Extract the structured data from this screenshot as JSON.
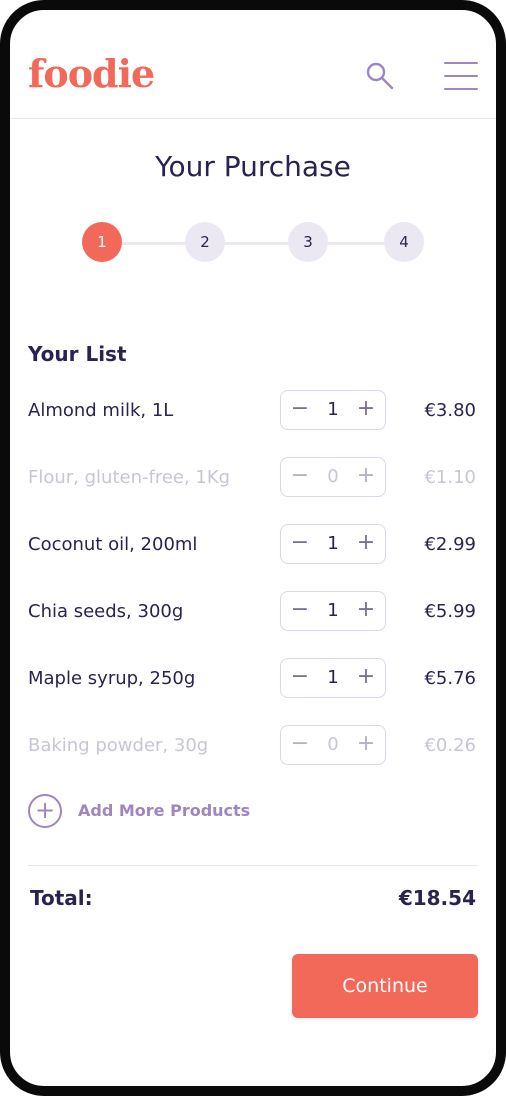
{
  "header": {
    "logo": "foodie",
    "search_icon": "search-icon",
    "menu_icon": "hamburger-menu-icon"
  },
  "title": "Your Purchase",
  "steps": [
    {
      "label": "1",
      "active": true
    },
    {
      "label": "2",
      "active": false
    },
    {
      "label": "3",
      "active": false
    },
    {
      "label": "4",
      "active": false
    }
  ],
  "list": {
    "heading": "Your List",
    "items": [
      {
        "name": "Almond milk, 1L",
        "qty": "1",
        "price": "€3.80",
        "muted": false
      },
      {
        "name": "Flour, gluten-free, 1Kg",
        "qty": "0",
        "price": "€1.10",
        "muted": true
      },
      {
        "name": "Coconut oil, 200ml",
        "qty": "1",
        "price": "€2.99",
        "muted": false
      },
      {
        "name": "Chia seeds, 300g",
        "qty": "1",
        "price": "€5.99",
        "muted": false
      },
      {
        "name": "Maple syrup, 250g",
        "qty": "1",
        "price": "€5.76",
        "muted": false
      },
      {
        "name": "Baking powder, 30g",
        "qty": "0",
        "price": "€0.26",
        "muted": true
      }
    ],
    "minus_symbol": "−",
    "plus_symbol": "+"
  },
  "add_more": {
    "icon": "plus-circle-icon",
    "label": "Add More Products"
  },
  "total": {
    "label": "Total:",
    "value": "€18.54"
  },
  "continue_label": "Continue",
  "colors": {
    "brand": "#f2695a",
    "accent": "#9f86c0",
    "text": "#2a2350",
    "muted_text": "#c9c5d3"
  }
}
